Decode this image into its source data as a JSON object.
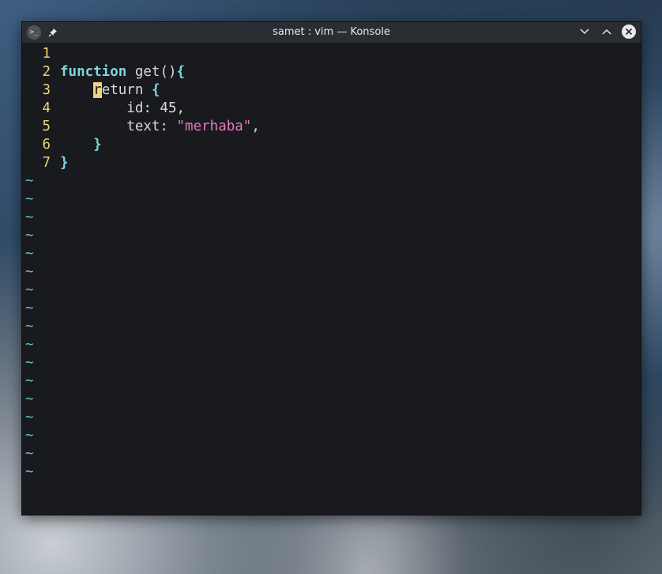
{
  "window": {
    "title": "samet : vim — Konsole",
    "app_icon_text": ">_",
    "icons": [
      "terminal-app-icon",
      "pin-icon",
      "minimize-icon",
      "maximize-icon",
      "close-icon"
    ]
  },
  "editor": {
    "lines": [
      {
        "num": "1",
        "segments": []
      },
      {
        "num": "2",
        "segments": [
          {
            "t": "function",
            "c": "kw"
          },
          {
            "t": " get()",
            "c": "plain"
          },
          {
            "t": "{",
            "c": "br"
          }
        ]
      },
      {
        "num": "3",
        "segments": [
          {
            "t": "    ",
            "c": "plain"
          },
          {
            "t": "r",
            "c": "cursor"
          },
          {
            "t": "eturn",
            "c": "plain"
          },
          {
            "t": " ",
            "c": "plain"
          },
          {
            "t": "{",
            "c": "br"
          }
        ]
      },
      {
        "num": "4",
        "segments": [
          {
            "t": "        id: 45,",
            "c": "plain"
          }
        ]
      },
      {
        "num": "5",
        "segments": [
          {
            "t": "        text: ",
            "c": "plain"
          },
          {
            "t": "\"merhaba\"",
            "c": "str"
          },
          {
            "t": ",",
            "c": "plain"
          }
        ]
      },
      {
        "num": "6",
        "segments": [
          {
            "t": "    ",
            "c": "plain"
          },
          {
            "t": "}",
            "c": "br"
          }
        ]
      },
      {
        "num": "7",
        "segments": [
          {
            "t": "}",
            "c": "br"
          }
        ]
      }
    ],
    "tilde_char": "~",
    "tilde_count": 17
  },
  "colors": {
    "keyword": "#7fd6df",
    "string": "#e878c0",
    "line_number": "#f0d37a",
    "cursor": "#f0d37a",
    "tilde": "#6cc3d3"
  }
}
